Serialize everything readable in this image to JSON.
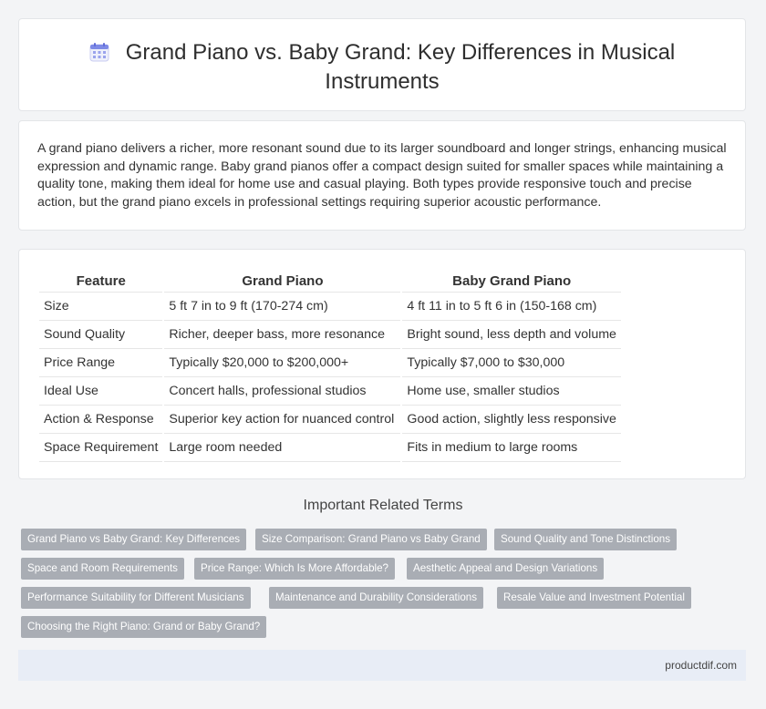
{
  "header": {
    "icon": "calendar-icon",
    "title": "Grand Piano vs. Baby Grand: Key Differences in Musical Instruments"
  },
  "summary": "A grand piano delivers a richer, more resonant sound due to its larger soundboard and longer strings, enhancing musical expression and dynamic range. Baby grand pianos offer a compact design suited for smaller spaces while maintaining a quality tone, making them ideal for home use and casual playing. Both types provide responsive touch and precise action, but the grand piano excels in professional settings requiring superior acoustic performance.",
  "table": {
    "headers": [
      "Feature",
      "Grand Piano",
      "Baby Grand Piano"
    ],
    "rows": [
      [
        "Size",
        "5 ft 7 in to 9 ft (170-274 cm)",
        "4 ft 11 in to 5 ft 6 in (150-168 cm)"
      ],
      [
        "Sound Quality",
        "Richer, deeper bass, more resonance",
        "Bright sound, less depth and volume"
      ],
      [
        "Price Range",
        "Typically $20,000 to $200,000+",
        "Typically $7,000 to $30,000"
      ],
      [
        "Ideal Use",
        "Concert halls, professional studios",
        "Home use, smaller studios"
      ],
      [
        "Action & Response",
        "Superior key action for nuanced control",
        "Good action, slightly less responsive"
      ],
      [
        "Space Requirement",
        "Large room needed",
        "Fits in medium to large rooms"
      ]
    ]
  },
  "related": {
    "title": "Important Related Terms",
    "tags": [
      "Grand Piano vs Baby Grand: Key Differences",
      "Size Comparison: Grand Piano vs Baby Grand",
      "Sound Quality and Tone Distinctions",
      "Space and Room Requirements",
      "Price Range: Which Is More Affordable?",
      "Aesthetic Appeal and Design Variations",
      "Performance Suitability for Different Musicians",
      "Maintenance and Durability Considerations",
      "Resale Value and Investment Potential",
      "Choosing the Right Piano: Grand or Baby Grand?"
    ]
  },
  "footer": {
    "site": "productdif.com"
  },
  "colors": {
    "tag_bg": "#a9adb4",
    "footer_bg": "#e8edf6",
    "page_bg": "#f3f4f6"
  }
}
